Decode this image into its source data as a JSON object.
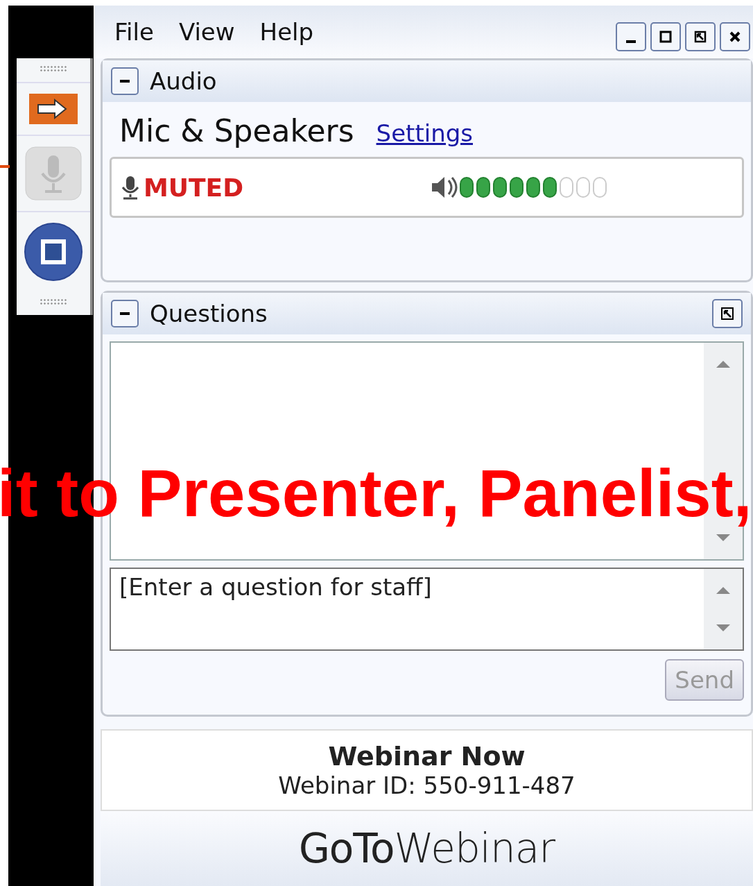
{
  "menu": [
    "File",
    "View",
    "Help"
  ],
  "audio": {
    "title": "Audio",
    "expanded": true,
    "mode": "Mic & Speakers",
    "settings_link": "Settings",
    "status": "MUTED",
    "level": 0.67
  },
  "questions": {
    "title": "Questions",
    "expanded": true,
    "input_placeholder": "[Enter a question for staff]",
    "send": {
      "label": "Send",
      "disabled": true
    }
  },
  "webinar": {
    "title": "Webinar Now",
    "id_line": "Webinar ID: 550-911-487"
  },
  "logo": "**GoTo**Webinar",
  "annotation": "it to Presenter, Panelist,"
}
